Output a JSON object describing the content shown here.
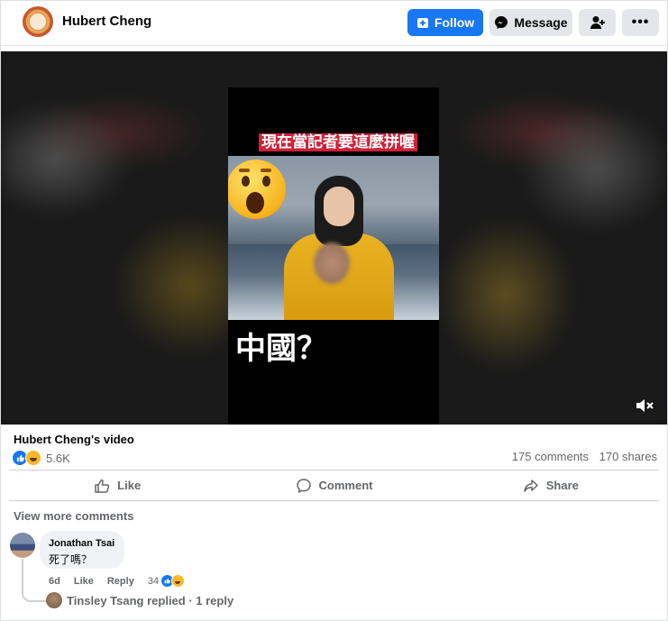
{
  "header": {
    "profile_name": "Hubert Cheng",
    "follow_label": "Follow",
    "message_label": "Message",
    "more_label": "•••"
  },
  "video": {
    "caption_top": "現在當記者要這麼拼喔",
    "caption_bottom": "中國？",
    "muted": true
  },
  "post": {
    "title": "Hubert Cheng's video",
    "reaction_count": "5.6K",
    "comments_count": "175 comments",
    "shares_count": "170 shares"
  },
  "actions": {
    "like": "Like",
    "comment": "Comment",
    "share": "Share"
  },
  "comments_section": {
    "view_more": "View more comments",
    "comment": {
      "author": "Jonathan Tsai",
      "text": "死了嗎？",
      "age": "6d",
      "like": "Like",
      "reply": "Reply",
      "reaction_count": "34"
    },
    "reply_summary": "Tinsley Tsang replied · 1 reply"
  },
  "colors": {
    "accent": "#1877f2",
    "button_gray": "#e4e6eb",
    "secondary_text": "#65676b",
    "caption_red": "#d0213a"
  }
}
